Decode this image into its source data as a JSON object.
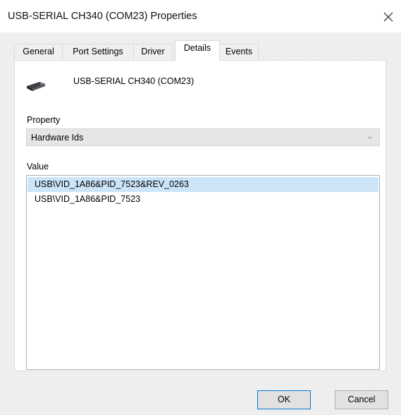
{
  "window": {
    "title": "USB-SERIAL CH340 (COM23) Properties"
  },
  "tabs": [
    {
      "label": "General"
    },
    {
      "label": "Port Settings"
    },
    {
      "label": "Driver"
    },
    {
      "label": "Details",
      "active": true
    },
    {
      "label": "Events"
    }
  ],
  "device": {
    "name": "USB-SERIAL CH340 (COM23)",
    "icon": "serial-device-icon"
  },
  "property": {
    "label": "Property",
    "selected": "Hardware Ids"
  },
  "value": {
    "label": "Value",
    "items": [
      {
        "text": "USB\\VID_1A86&PID_7523&REV_0263",
        "selected": true
      },
      {
        "text": "USB\\VID_1A86&PID_7523",
        "selected": false
      }
    ]
  },
  "buttons": {
    "ok": "OK",
    "cancel": "Cancel"
  },
  "colors": {
    "selection": "#cce4f7",
    "default_button_border": "#0078d7"
  }
}
